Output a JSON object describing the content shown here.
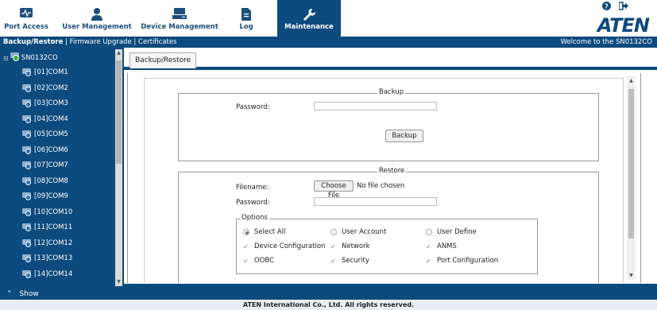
{
  "nav": {
    "items": [
      {
        "label": "Port Access",
        "icon": "monitor-icon"
      },
      {
        "label": "User Management",
        "icon": "user-icon"
      },
      {
        "label": "Device Management",
        "icon": "server-icon"
      },
      {
        "label": "Log",
        "icon": "document-icon"
      },
      {
        "label": "Maintenance",
        "icon": "wrench-icon"
      }
    ],
    "active": "Maintenance",
    "logo": "ATEN"
  },
  "subbar": {
    "crumb_active": "Backup/Restore",
    "links": [
      "Firmware Upgrade",
      "Certificates"
    ],
    "separator": "|",
    "welcome": "Welcome to the SN0132CO"
  },
  "sidebar": {
    "root": "SN0132CO",
    "ports": [
      "[01]COM1",
      "[02]COM2",
      "[03]COM3",
      "[04]COM4",
      "[05]COM5",
      "[06]COM6",
      "[07]COM7",
      "[08]COM8",
      "[09]COM9",
      "[10]COM10",
      "[11]COM11",
      "[12]COM12",
      "[13]COM13",
      "[14]COM14"
    ],
    "show_label": "Show",
    "collapse_glyph": "⊟"
  },
  "tab": {
    "label": "Backup/Restore"
  },
  "backup": {
    "legend": "Backup",
    "password_label": "Password:",
    "button": "Backup"
  },
  "restore": {
    "legend": "Restore",
    "filename_label": "Filename:",
    "choose_button": "Choose File",
    "no_file": "No file chosen",
    "password_label": "Password:",
    "options_legend": "Options",
    "radios": [
      {
        "label": "Select All",
        "checked": true
      },
      {
        "label": "User Account",
        "checked": false
      },
      {
        "label": "User Define",
        "checked": false
      }
    ],
    "checks": [
      [
        "Device Configuration",
        "Network",
        "ANMS"
      ],
      [
        "OOBC",
        "Security",
        "Port Configuration"
      ]
    ]
  },
  "footer": "ATEN International Co., Ltd. All rights reserved.",
  "colors": {
    "brand": "#0d4a7d",
    "footer_bg": "#e8eef3"
  }
}
